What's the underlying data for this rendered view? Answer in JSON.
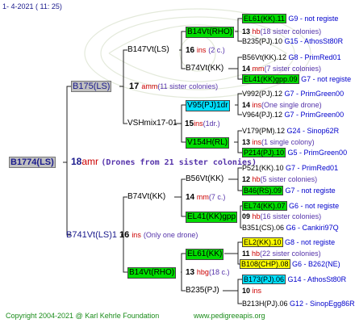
{
  "header": {
    "date": "1-  4-2021  ( 11: 25)"
  },
  "footer": {
    "copyright": "Copyright 2004-2021 @ Karl Kehrle Foundation",
    "site": "www.pedigreeapis.org"
  },
  "colors": {
    "line": "#222222",
    "green": "#00dd00",
    "cyan": "#00e0ff",
    "yellow": "#ffff00",
    "gray": "#c0c0c0",
    "red": "#cc0000",
    "purple": "#5533aa",
    "blue": "#0000cc",
    "navy": "#1a1a8c"
  },
  "root": {
    "name": "B1774(LS)",
    "num": "18",
    "code": "amr",
    "note": "(Drones from 21 sister colonies)"
  },
  "gen1": [
    {
      "name": "B175(LS)",
      "num": "17",
      "code": "amm",
      "note": "(11 sister colonies)"
    },
    {
      "name": "B741Vt(LS)1",
      "num": "16",
      "code": "ins",
      "note": "(Only one drone)"
    }
  ],
  "gen2": [
    {
      "name": "B147Vt(LS)",
      "num": "16",
      "code": "ins",
      "note": "(2 c.)"
    },
    {
      "name": "VSHmix17-01",
      "num": "15",
      "code": "ins",
      "note": "(1dr.)"
    },
    {
      "name": "B74Vt(KK)",
      "num": "14",
      "code": "mm",
      "note": "(7 c.)"
    },
    {
      "name": "B14Vt(RHO)",
      "num": "13",
      "code": "hbg",
      "note": "(18 c.)"
    }
  ],
  "gen3": [
    {
      "name": "B14Vt(RHO)",
      "num": "13",
      "code": "hb",
      "note": "(18 sister colonies)"
    },
    {
      "name": "B74Vt(KK)",
      "num": "14",
      "code": "mm",
      "note": "(7 sister colonies)"
    },
    {
      "name": "V95(PJ)1dr",
      "num": "14",
      "code": "ins",
      "note": "(One single drone)"
    },
    {
      "name": "V154H(RL)",
      "num": "13",
      "code": "ins",
      "note": "(1 single colony)"
    },
    {
      "name": "B56Vt(KK)",
      "num": "12",
      "code": "hb",
      "note": "(5 sister colonies)"
    },
    {
      "name": "EL41(KK)gpp",
      "num": "09",
      "code": "hb",
      "note": "(16 sister colonies)"
    },
    {
      "name": "EL61(KK)",
      "num": "11",
      "code": "hb",
      "note": "(22 sister colonies)"
    },
    {
      "name": "B235(PJ)",
      "num": "10",
      "code": "ins",
      "note": ""
    }
  ],
  "gen4": [
    {
      "name": "EL61(KK).11",
      "info": "G9 - not registe"
    },
    {
      "name": "B235(PJ).10",
      "info": "G15 - AthosSt80R"
    },
    {
      "name": "B56Vt(KK).12",
      "info": "G8 - PrimRed01"
    },
    {
      "name": "EL41(KK)gpp.09",
      "info": "G7 - not registe"
    },
    {
      "name": "V992(PJ).12",
      "info": "G7 - PrimGreen00"
    },
    {
      "name": "V964(PJ).12",
      "info": "G7 - PrimGreen00"
    },
    {
      "name": "V179(PM).12",
      "info": "G24 - Sinop62R"
    },
    {
      "name": "P214(PJ).10",
      "info": "G5 - PrimGreen00"
    },
    {
      "name": "P521(KK).10",
      "info": "G7 - PrimRed01"
    },
    {
      "name": "B46(RS).09",
      "info": "G7 - not registe"
    },
    {
      "name": "EL74(KK).07",
      "info": "G6 - not registe"
    },
    {
      "name": "B351(CS).06",
      "info": "G6 - Cankiri97Q"
    },
    {
      "name": "EL2(KK).10",
      "info": "G8 - not registe"
    },
    {
      "name": "B108(CHP).08",
      "info": "G6 - B262(NE)"
    },
    {
      "name": "B173(PJ).06",
      "info": "G14 - AthosSt80R"
    },
    {
      "name": "B213H(PJ).06",
      "info": "G12 - SinopEgg86R"
    }
  ]
}
